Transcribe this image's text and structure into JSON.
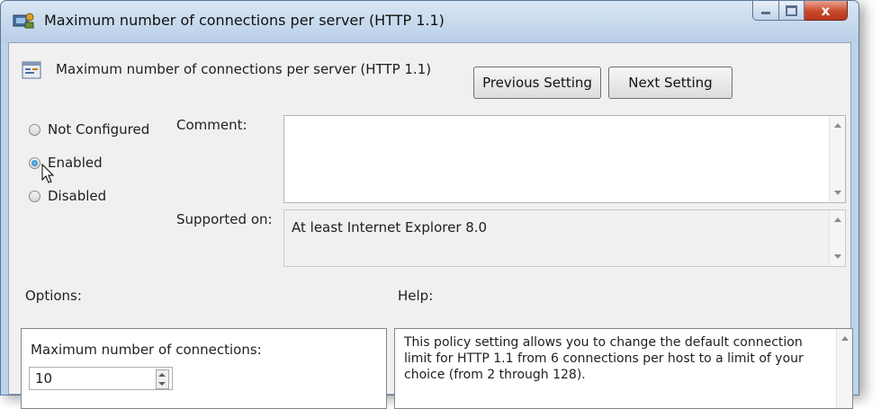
{
  "window": {
    "title": "Maximum number of connections per server (HTTP 1.1)",
    "close_glyph": "x"
  },
  "header": {
    "title": "Maximum number of connections per server (HTTP 1.1)",
    "prev_button": "Previous Setting",
    "next_button": "Next Setting"
  },
  "state": {
    "options": [
      {
        "label": "Not Configured",
        "checked": false
      },
      {
        "label": "Enabled",
        "checked": true
      },
      {
        "label": "Disabled",
        "checked": false
      }
    ]
  },
  "fields": {
    "comment_label": "Comment:",
    "comment_value": "",
    "supported_label": "Supported on:",
    "supported_value": "At least Internet Explorer 8.0"
  },
  "options_panel": {
    "heading": "Options:",
    "field_label": "Maximum number of connections:",
    "field_value": "10"
  },
  "help_panel": {
    "heading": "Help:",
    "text": "This policy setting allows you to change the default connection limit for HTTP 1.1 from 6 connections per host to a limit of your choice (from 2 through 128)."
  },
  "icons": {
    "app": "group-policy-icon",
    "header": "setting-icon",
    "cursor": "mouse-cursor-icon"
  },
  "colors": {
    "title_bar": "#c4d7ec",
    "close_button": "#c9492c",
    "radio_selected": "#1b6fb5",
    "dialog_background": "#f0f0f0"
  }
}
